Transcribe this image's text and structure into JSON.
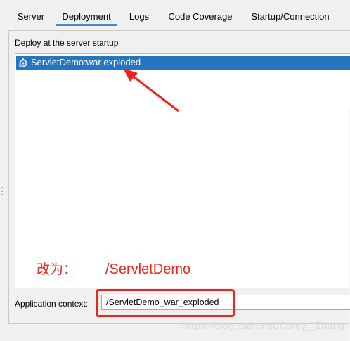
{
  "tabs": [
    {
      "label": "Server"
    },
    {
      "label": "Deployment"
    },
    {
      "label": "Logs"
    },
    {
      "label": "Code Coverage"
    },
    {
      "label": "Startup/Connection"
    }
  ],
  "selected_tab": "Deployment",
  "deploy_group": {
    "title": "Deploy at the server startup",
    "items": [
      {
        "label": "ServletDemo:war exploded",
        "icon": "artifact-icon",
        "selected": true
      }
    ]
  },
  "annotation": {
    "label": "改为：",
    "value": "/ServletDemo"
  },
  "application_context": {
    "label": "Application context:",
    "value": "/ServletDemo_war_exploded"
  },
  "watermark": "https://blog.csdn.net/Corey__Zhang",
  "colors": {
    "selection": "#2675bf",
    "annotation": "#e8261e",
    "tab_underline": "#4a88c7"
  }
}
